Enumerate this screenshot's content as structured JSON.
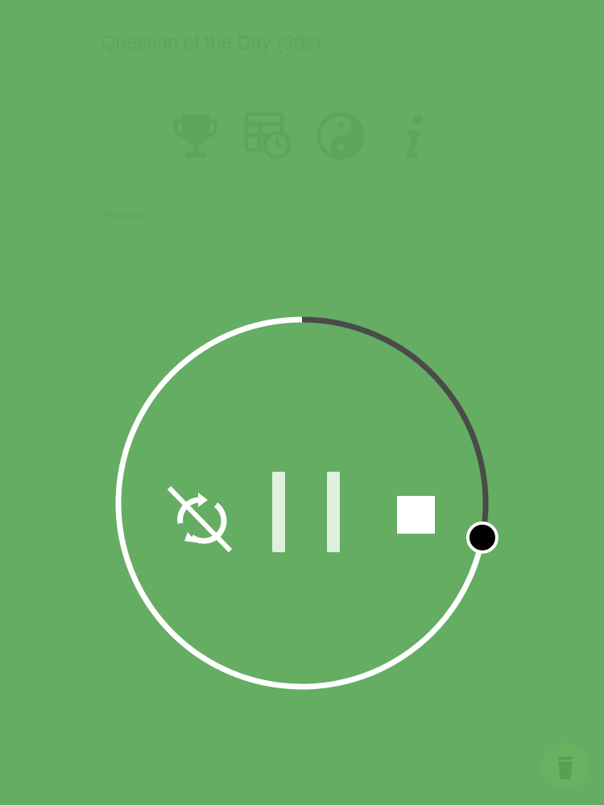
{
  "header": {
    "title": "Question of the Day (30s)"
  },
  "toolbar": {
    "icons": [
      "trophy-icon",
      "schedule-icon",
      "yin-yang-icon",
      "info-icon"
    ]
  },
  "subtitle": "Reveal",
  "timer": {
    "progress_fraction": 0.28,
    "remaining_arc_color": "#ffffff",
    "elapsed_arc_color": "#4a4a4a",
    "handle_color": "#000000",
    "controls": {
      "repeat_off": "repeat-off-icon",
      "pause": "pause-icon",
      "stop": "stop-icon"
    }
  },
  "footer": {
    "left_label": "",
    "center_label": "",
    "right_label": ""
  },
  "tip_button": {
    "icon": "cup-icon"
  },
  "colors": {
    "background": "#64ad62",
    "control_light": "#dff0dd",
    "white": "#ffffff"
  }
}
